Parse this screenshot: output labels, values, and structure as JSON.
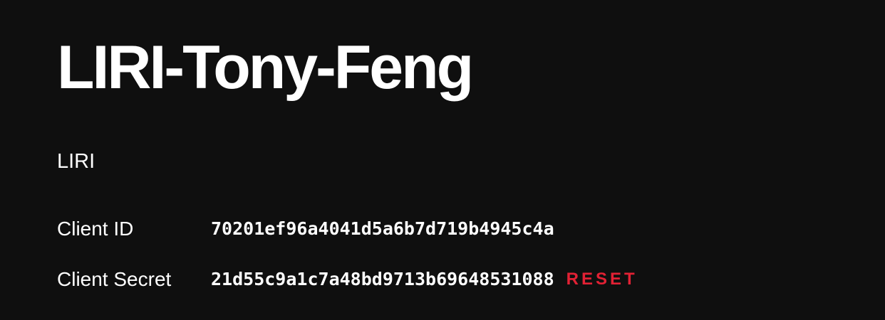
{
  "app": {
    "title": "LIRI-Tony-Feng",
    "description": "LIRI"
  },
  "credentials": {
    "client_id": {
      "label": "Client ID",
      "value": "70201ef96a4041d5a6b7d719b4945c4a"
    },
    "client_secret": {
      "label": "Client Secret",
      "value": "21d55c9a1c7a48bd9713b69648531088",
      "reset_label": "RESET"
    }
  },
  "colors": {
    "background": "#0f0f0f",
    "text": "#ffffff",
    "accent": "#e22134"
  }
}
